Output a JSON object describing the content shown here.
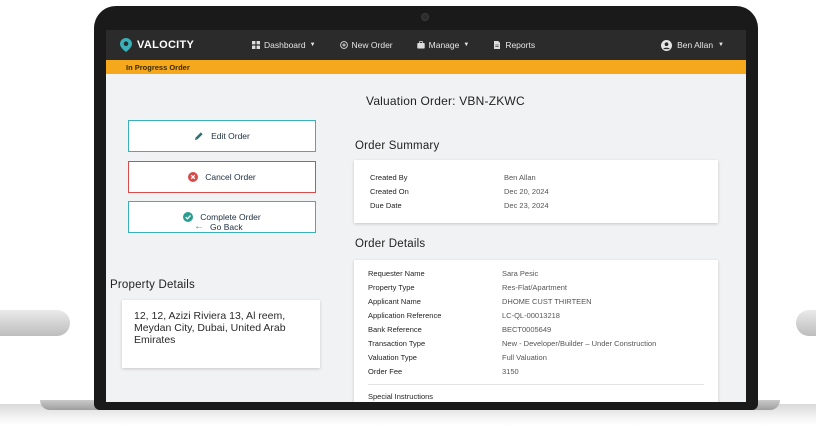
{
  "nav": {
    "brand": "VALOCITY",
    "items": [
      {
        "label": "Dashboard",
        "icon": "dashboard-icon",
        "dropdown": true
      },
      {
        "label": "New Order",
        "icon": "plus-circle-icon",
        "dropdown": false
      },
      {
        "label": "Manage",
        "icon": "briefcase-icon",
        "dropdown": true
      },
      {
        "label": "Reports",
        "icon": "document-icon",
        "dropdown": false
      }
    ],
    "user": "Ben Allan"
  },
  "status_label": "In Progress Order",
  "page_title": "Valuation Order: VBN-ZKWC",
  "actions": {
    "edit": "Edit Order",
    "cancel": "Cancel Order",
    "complete": "Complete Order",
    "back": "Go Back"
  },
  "property": {
    "heading": "Property Details",
    "address": "12, 12, Azizi Riviera 13, Al reem, Meydan City, Dubai, United Arab Emirates"
  },
  "order_summary": {
    "heading": "Order Summary",
    "rows": [
      {
        "label": "Created By",
        "value": "Ben Allan"
      },
      {
        "label": "Created On",
        "value": "Dec 20, 2024"
      },
      {
        "label": "Due Date",
        "value": "Dec 23, 2024"
      }
    ]
  },
  "order_details": {
    "heading": "Order Details",
    "rows": [
      {
        "label": "Requester Name",
        "value": "Sara Pesic"
      },
      {
        "label": "Property Type",
        "value": "Res-Flat/Apartment"
      },
      {
        "label": "Applicant Name",
        "value": "DHOME CUST THIRTEEN"
      },
      {
        "label": "Application Reference",
        "value": "LC-QL-00013218"
      },
      {
        "label": "Bank Reference",
        "value": "BECT0005649"
      },
      {
        "label": "Transaction Type",
        "value": "New - Developer/Builder – Under Construction"
      },
      {
        "label": "Valuation Type",
        "value": "Full Valuation"
      },
      {
        "label": "Order Fee",
        "value": "3150"
      }
    ],
    "special_instructions_label": "Special Instructions"
  },
  "colors": {
    "nav_bg": "#2b2b2b",
    "status_bar": "#f5a81c",
    "accent_teal": "#3ab0b8",
    "cancel_red": "#d94a4a",
    "complete_icon": "#2a9d8f"
  }
}
